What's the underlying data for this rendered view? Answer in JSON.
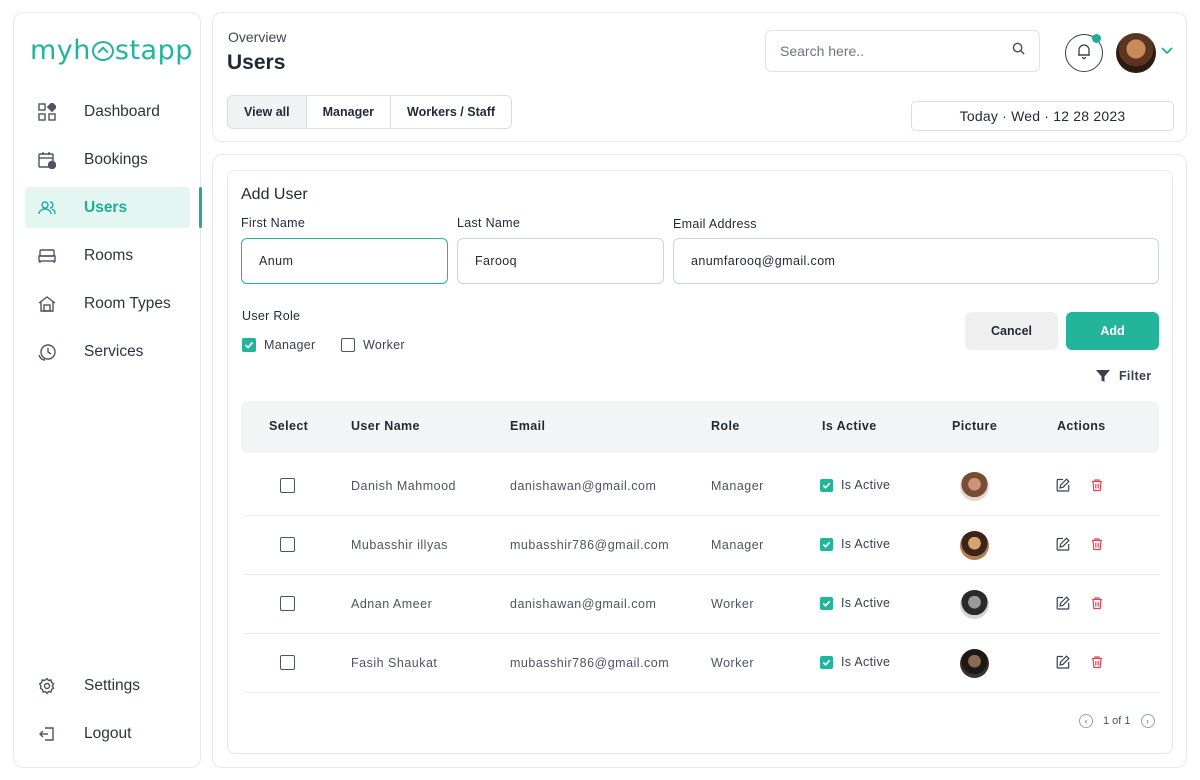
{
  "app": {
    "logo_text_a": "my",
    "logo_text_b": "h",
    "logo_text_c": "stapp"
  },
  "sidebar": {
    "items": [
      {
        "label": "Dashboard",
        "icon": "dashboard-icon"
      },
      {
        "label": "Bookings",
        "icon": "calendar-icon"
      },
      {
        "label": "Users",
        "icon": "users-icon",
        "active": true
      },
      {
        "label": "Rooms",
        "icon": "bed-icon"
      },
      {
        "label": "Room Types",
        "icon": "home-icon"
      },
      {
        "label": "Services",
        "icon": "service-clock-icon"
      }
    ],
    "bottom": [
      {
        "label": "Settings",
        "icon": "gear-icon"
      },
      {
        "label": "Logout",
        "icon": "logout-icon"
      }
    ]
  },
  "header": {
    "breadcrumb": "Overview",
    "title": "Users",
    "search_placeholder": "Search here..",
    "tabs": [
      {
        "label": "View all",
        "active": true
      },
      {
        "label": "Manager"
      },
      {
        "label": "Workers / Staff"
      }
    ],
    "date": "Today · Wed · 12 28 2023"
  },
  "form": {
    "title": "Add User",
    "first_name_label": "First Name",
    "first_name_value": "Anum",
    "last_name_label": "Last Name",
    "last_name_value": "Farooq",
    "email_label": "Email Address",
    "email_value": "anumfarooq@gmail.com",
    "role_label": "User Role",
    "roles": [
      {
        "label": "Manager",
        "checked": true
      },
      {
        "label": "Worker",
        "checked": false
      }
    ],
    "cancel_label": "Cancel",
    "add_label": "Add",
    "filter_label": "Filter"
  },
  "table": {
    "columns": [
      "Select",
      "User Name",
      "Email",
      "Role",
      "Is Active",
      "Picture",
      "Actions"
    ],
    "rows": [
      {
        "name": "Danish Mahmood",
        "email": "danishawan@gmail.com",
        "role": "Manager",
        "active_label": "Is Active"
      },
      {
        "name": "Mubasshir illyas",
        "email": "mubasshir786@gmail.com",
        "role": "Manager",
        "active_label": "Is Active"
      },
      {
        "name": "Adnan Ameer",
        "email": "danishawan@gmail.com",
        "role": "Worker",
        "active_label": "Is Active"
      },
      {
        "name": "Fasih Shaukat",
        "email": "mubasshir786@gmail.com",
        "role": "Worker",
        "active_label": "Is Active"
      }
    ],
    "pagination": "1 of 1"
  },
  "colors": {
    "accent": "#22b59b",
    "danger": "#e0444f"
  }
}
